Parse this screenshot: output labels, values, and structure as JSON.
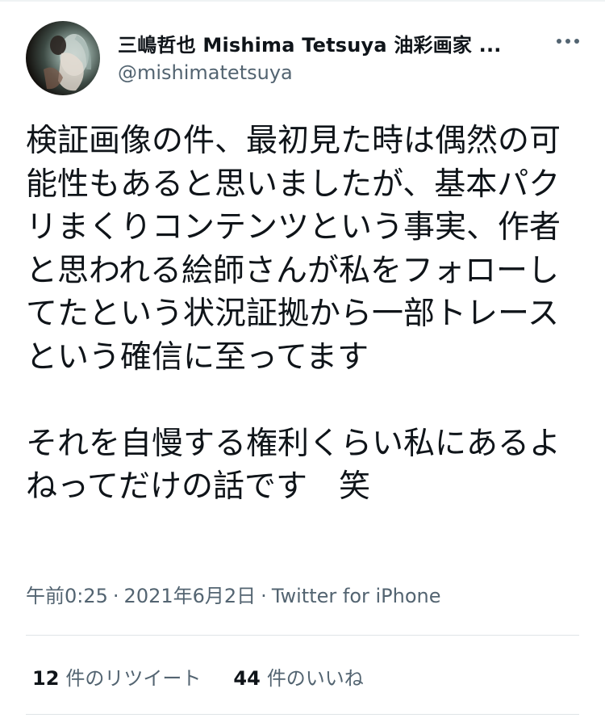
{
  "user": {
    "display_name": "三嶋哲也 Mishima Tetsuya 油彩画家 ...",
    "handle": "@mishimatetsuya"
  },
  "icons": {
    "avatar": "portrait-avatar",
    "more": "more-horizontal-icon"
  },
  "tweet": {
    "text": "検証画像の件、最初見た時は偶然の可能性もあると思いましたが、基本パクリまくりコンテンツという事実、作者と思われる絵師さんが私をフォローしてたという状況証拠から一部トレースという確信に至ってます\n\nそれを自慢する権利くらい私にあるよねってだけの話です　笑",
    "time": "午前0:25",
    "date": "2021年6月2日",
    "source": "Twitter for iPhone",
    "separator": "·"
  },
  "stats": {
    "retweets_count": "12",
    "retweets_label": "件のリツイート",
    "likes_count": "44",
    "likes_label": "件のいいね"
  },
  "colors": {
    "text": "#0f1419",
    "secondary": "#536471",
    "divider": "#dfe4e7"
  }
}
